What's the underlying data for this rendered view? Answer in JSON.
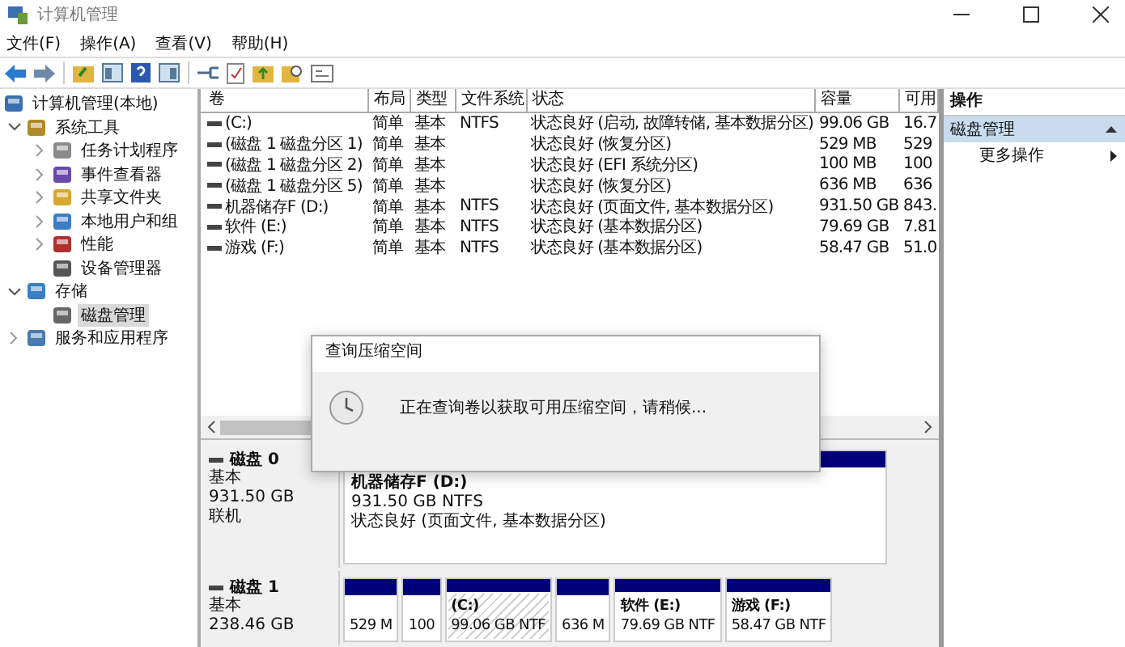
{
  "window": {
    "title": "计算机管理"
  },
  "menu": [
    "文件(F)",
    "操作(A)",
    "查看(V)",
    "帮助(H)"
  ],
  "tree": [
    {
      "label": "计算机管理(本地)",
      "selected": false,
      "children": [
        {
          "label": "系统工具",
          "selected": false,
          "expanded": true,
          "children": [
            {
              "label": "任务计划程序",
              "selected": false,
              "expanded": false
            },
            {
              "label": "事件查看器",
              "selected": false,
              "expanded": false
            },
            {
              "label": "共享文件夹",
              "selected": false,
              "expanded": false
            },
            {
              "label": "本地用户和组",
              "selected": false,
              "expanded": false
            },
            {
              "label": "性能",
              "selected": false,
              "expanded": false
            },
            {
              "label": "设备管理器",
              "selected": false
            }
          ]
        },
        {
          "label": "存储",
          "selected": false,
          "expanded": true,
          "children": [
            {
              "label": "磁盘管理",
              "selected": true
            }
          ]
        },
        {
          "label": "服务和应用程序",
          "selected": false,
          "expanded": false
        }
      ]
    }
  ],
  "table": {
    "columns": [
      "卷",
      "布局",
      "类型",
      "文件系统",
      "状态",
      "容量",
      "可用"
    ],
    "rows": [
      [
        "(C:)",
        "简单",
        "基本",
        "NTFS",
        "状态良好 (启动, 故障转储, 基本数据分区)",
        "99.06 GB",
        "16.7"
      ],
      [
        "(磁盘 1 磁盘分区 1)",
        "简单",
        "基本",
        "",
        "状态良好 (恢复分区)",
        "529 MB",
        "529"
      ],
      [
        "(磁盘 1 磁盘分区 2)",
        "简单",
        "基本",
        "",
        "状态良好 (EFI 系统分区)",
        "100 MB",
        "100"
      ],
      [
        "(磁盘 1 磁盘分区 5)",
        "简单",
        "基本",
        "",
        "状态良好 (恢复分区)",
        "636 MB",
        "636"
      ],
      [
        "机器储存F (D:)",
        "简单",
        "基本",
        "NTFS",
        "状态良好 (页面文件, 基本数据分区)",
        "931.50 GB",
        "843."
      ],
      [
        "软件 (E:)",
        "简单",
        "基本",
        "NTFS",
        "状态良好 (基本数据分区)",
        "79.69 GB",
        "7.81"
      ],
      [
        "游戏 (F:)",
        "简单",
        "基本",
        "NTFS",
        "状态良好 (基本数据分区)",
        "58.47 GB",
        "51.0"
      ]
    ]
  },
  "disks": [
    {
      "name": "磁盘 0",
      "type": "基本",
      "size": "931.50 GB",
      "status": "联机",
      "partitions": [
        {
          "name": "机器储存F  (D:)",
          "size": "931.50 GB NTFS",
          "status": "状态良好 (页面文件, 基本数据分区)",
          "selected": false
        }
      ]
    },
    {
      "name": "磁盘 1",
      "type": "基本",
      "size": "238.46 GB",
      "partitions": [
        {
          "size": "529 M",
          "selected": false
        },
        {
          "size": "100",
          "selected": false
        },
        {
          "name": "(C:)",
          "size": "99.06 GB NTF",
          "selected": true
        },
        {
          "size": "636 M",
          "selected": false
        },
        {
          "name": "软件  (E:)",
          "size": "79.69 GB NTF",
          "selected": false
        },
        {
          "name": "游戏  (F:)",
          "size": "58.47 GB NTF",
          "selected": false
        }
      ]
    }
  ],
  "dialog": {
    "title": "查询压缩空间",
    "message": "正在查询卷以获取可用压缩空间，请稍候..."
  },
  "actions": {
    "title": "操作",
    "sections": [
      {
        "label": "磁盘管理",
        "expanded": true,
        "items": [
          "更多操作"
        ]
      }
    ]
  }
}
